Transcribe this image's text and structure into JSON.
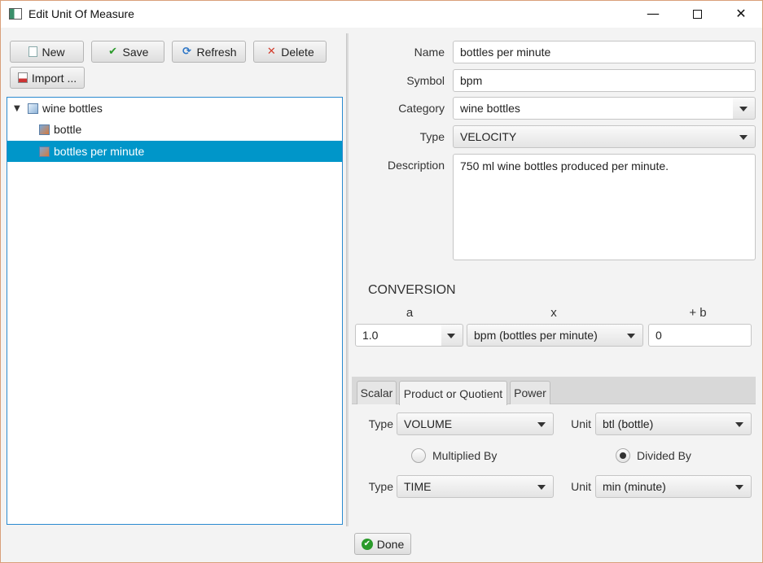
{
  "window": {
    "title": "Edit Unit Of Measure",
    "controls": {
      "minimize": "—",
      "maximize": "",
      "close": "✕"
    }
  },
  "toolbar": {
    "new_label": "New",
    "save_label": "Save",
    "refresh_label": "Refresh",
    "delete_label": "Delete",
    "import_label": "Import ..."
  },
  "tree": {
    "root": {
      "label": "wine bottles",
      "expanded": true,
      "icon": "folder-icon"
    },
    "children": [
      {
        "label": "bottle",
        "icon": "unit-icon",
        "selected": false
      },
      {
        "label": "bottles per minute",
        "icon": "unit-icon",
        "selected": true
      }
    ]
  },
  "form": {
    "name_label": "Name",
    "name_value": "bottles per minute",
    "symbol_label": "Symbol",
    "symbol_value": "bpm",
    "category_label": "Category",
    "category_value": "wine bottles",
    "type_label": "Type",
    "type_value": "VELOCITY",
    "description_label": "Description",
    "description_value": "750 ml wine bottles produced per minute."
  },
  "conversion": {
    "title": "CONVERSION",
    "col_a": "a",
    "col_x": "x",
    "col_b": "+ b",
    "a_value": "1.0",
    "x_value": "bpm (bottles per minute)",
    "b_value": "0"
  },
  "tabs": [
    {
      "label": "Scalar",
      "active": false
    },
    {
      "label": "Product or Quotient",
      "active": true
    },
    {
      "label": "Power",
      "active": false
    }
  ],
  "quotient": {
    "type_label": "Type",
    "unit_label": "Unit",
    "type1_value": "VOLUME",
    "unit1_value": "btl (bottle)",
    "multiplied_label": "Multiplied By",
    "divided_label": "Divided By",
    "operation": "divided",
    "type2_value": "TIME",
    "unit2_value": "min (minute)"
  },
  "footer": {
    "done_label": "Done"
  },
  "colors": {
    "selection": "#0096c9",
    "tree_border": "#2a8ad0",
    "save_check": "#2a9a2a",
    "delete_x": "#d23a2a",
    "done_icon": "#2a9a2a"
  }
}
